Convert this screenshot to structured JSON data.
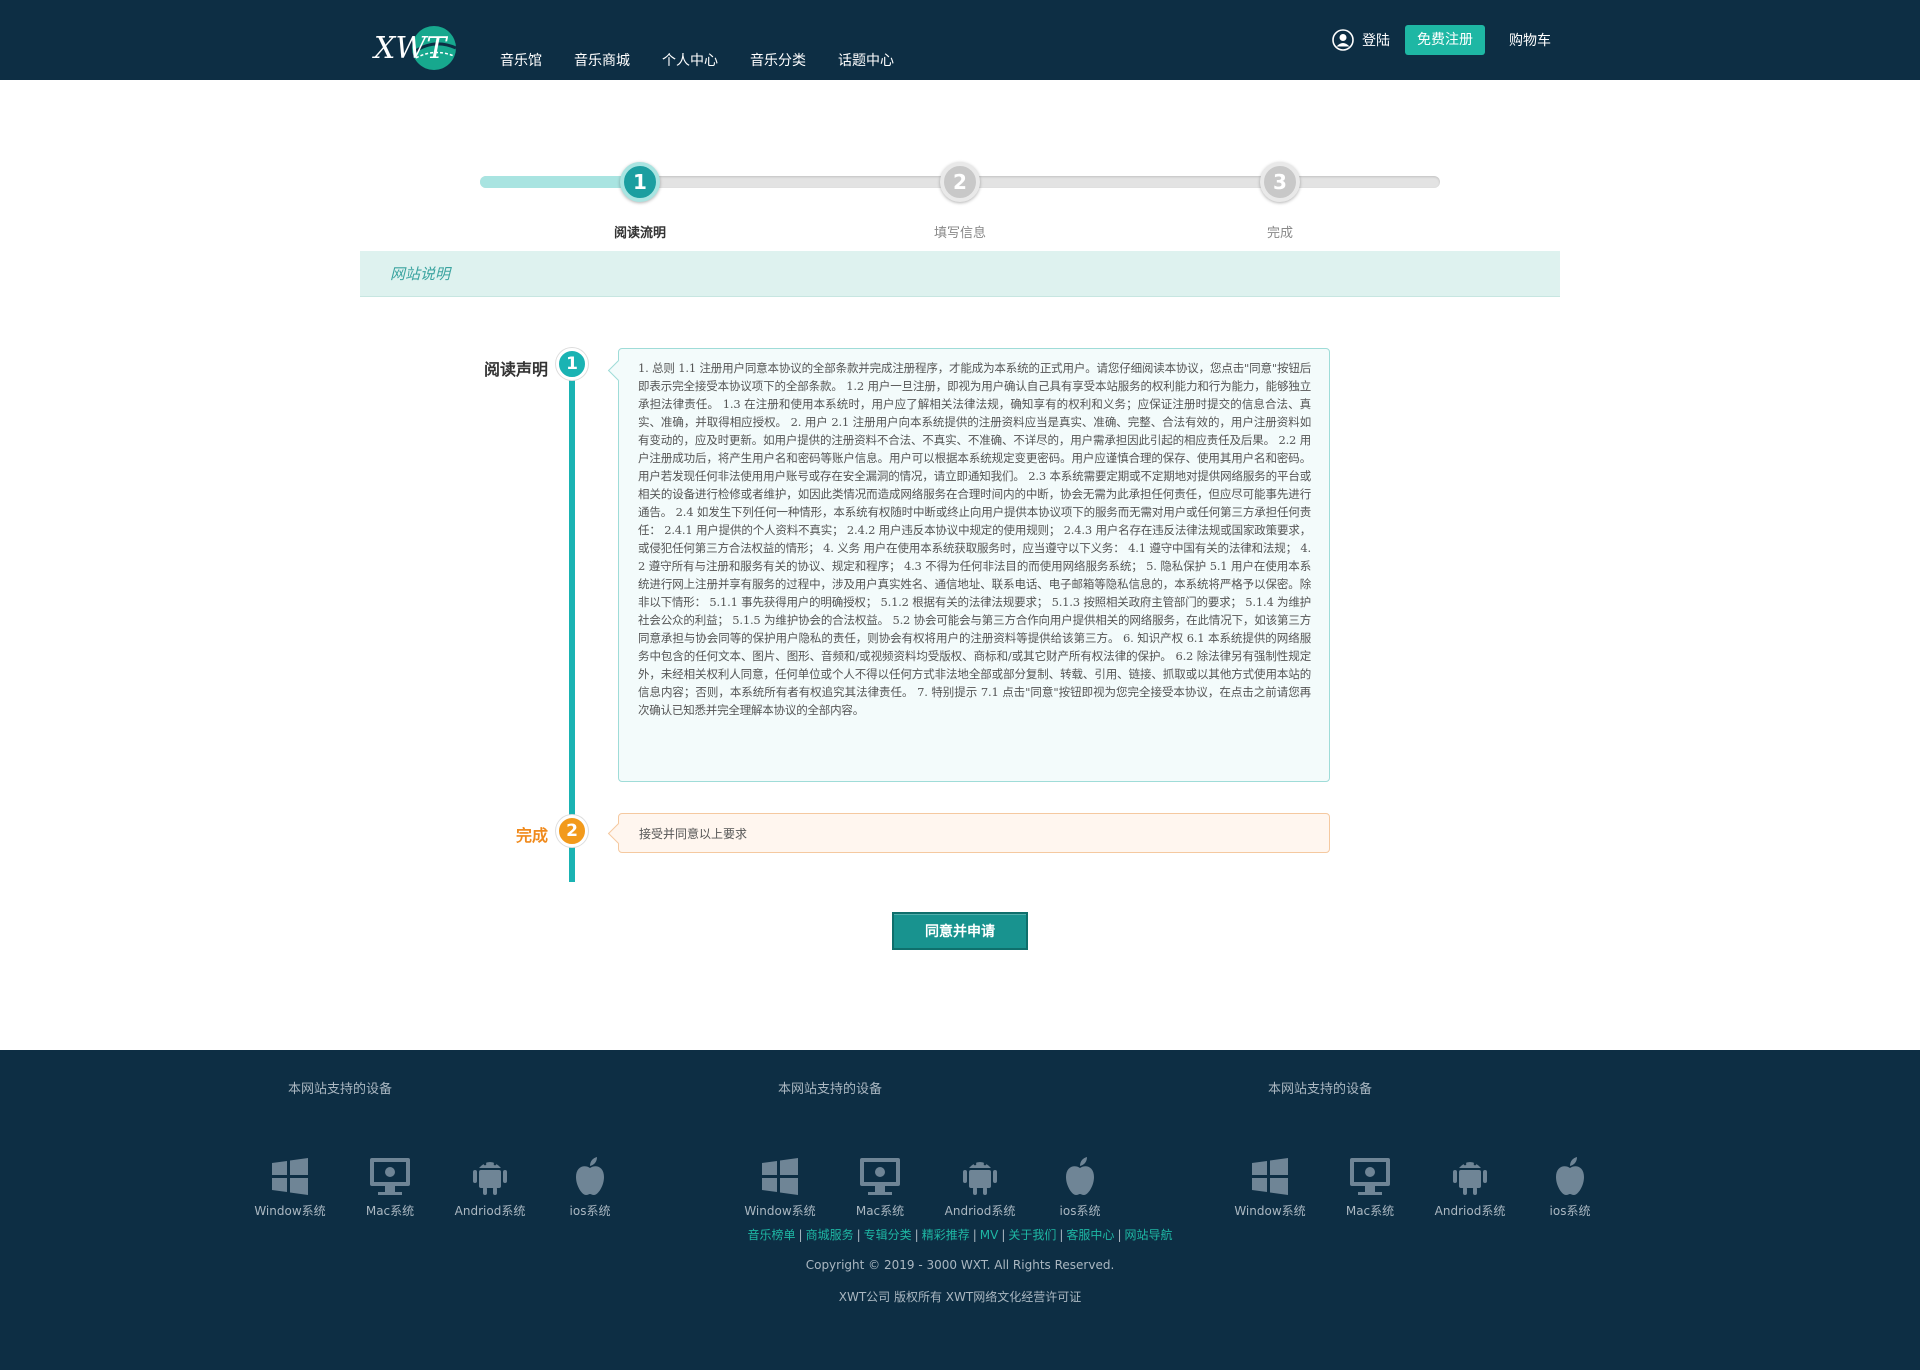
{
  "header": {
    "logo_text": "XWT",
    "nav": [
      "音乐馆",
      "音乐商城",
      "个人中心",
      "音乐分类",
      "话题中心"
    ],
    "login_label": "登陆",
    "register_label": "免费注册",
    "cart_label": "购物车",
    "colors": {
      "bar": "#0d2e44",
      "accent": "#1eb7a4"
    }
  },
  "steps": {
    "items": [
      {
        "number": "1",
        "label": "阅读流明",
        "active": true
      },
      {
        "number": "2",
        "label": "填写信息",
        "active": false
      },
      {
        "number": "3",
        "label": "完成",
        "active": false
      }
    ]
  },
  "section": {
    "title": "网站说明"
  },
  "timeline": {
    "read_title": "阅读声明",
    "read_number": "1",
    "agreement_text": "1. 总则 1.1 注册用户同意本协议的全部条款并完成注册程序，才能成为本系统的正式用户。请您仔细阅读本协议，您点击\"同意\"按钮后即表示完全接受本协议项下的全部条款。 1.2 用户一旦注册，即视为用户确认自己具有享受本站服务的权利能力和行为能力，能够独立承担法律责任。 1.3 在注册和使用本系统时，用户应了解相关法律法规，确知享有的权利和义务；应保证注册时提交的信息合法、真实、准确，并取得相应授权。 2. 用户 2.1 注册用户向本系统提供的注册资料应当是真实、准确、完整、合法有效的，用户注册资料如有变动的，应及时更新。如用户提供的注册资料不合法、不真实、不准确、不详尽的，用户需承担因此引起的相应责任及后果。 2.2 用户注册成功后，将产生用户名和密码等账户信息。用户可以根据本系统规定变更密码。用户应谨慎合理的保存、使用其用户名和密码。用户若发现任何非法使用用户账号或存在安全漏洞的情况，请立即通知我们。 2.3 本系统需要定期或不定期地对提供网络服务的平台或相关的设备进行检修或者维护，如因此类情况而造成网络服务在合理时间内的中断，协会无需为此承担任何责任，但应尽可能事先进行通告。 2.4 如发生下列任何一种情形，本系统有权随时中断或终止向用户提供本协议项下的服务而无需对用户或任何第三方承担任何责任： 2.4.1 用户提供的个人资料不真实； 2.4.2 用户违反本协议中规定的使用规则； 2.4.3 用户名存在违反法律法规或国家政策要求，或侵犯任何第三方合法权益的情形； 4. 义务 用户在使用本系统获取服务时，应当遵守以下义务： 4.1 遵守中国有关的法律和法规； 4.2 遵守所有与注册和服务有关的协议、规定和程序； 4.3 不得为任何非法目的而使用网络服务系统； 5. 隐私保护 5.1 用户在使用本系统进行网上注册并享有服务的过程中，涉及用户真实姓名、通信地址、联系电话、电子邮箱等隐私信息的，本系统将严格予以保密。除非以下情形： 5.1.1 事先获得用户的明确授权； 5.1.2 根据有关的法律法规要求； 5.1.3 按照相关政府主管部门的要求； 5.1.4 为维护社会公众的利益； 5.1.5 为维护协会的合法权益。 5.2 协会可能会与第三方合作向用户提供相关的网络服务，在此情况下，如该第三方同意承担与协会同等的保护用户隐私的责任，则协会有权将用户的注册资料等提供给该第三方。 6. 知识产权 6.1 本系统提供的网络服务中包含的任何文本、图片、图形、音频和/或视频资料均受版权、商标和/或其它财产所有权法律的保护。 6.2 除法律另有强制性规定外，未经相关权利人同意，任何单位或个人不得以任何方式非法地全部或部分复制、转载、引用、链接、抓取或以其他方式使用本站的信息内容；否则，本系统所有者有权追究其法律责任。 7. 特别提示 7.1 点击\"同意\"按钮即视为您完全接受本协议，在点击之前请您再次确认已知悉并完全理解本协议的全部内容。",
    "done_title": "完成",
    "done_number": "2",
    "accept_text": "接受并同意以上要求"
  },
  "agree_button": "同意并申请",
  "footer": {
    "device_groups": [
      {
        "title": "本网站支持的设备",
        "devices": [
          "Window系统",
          "Mac系统",
          "Andriod系统",
          "ios系统"
        ]
      },
      {
        "title": "本网站支持的设备",
        "devices": [
          "Window系统",
          "Mac系统",
          "Andriod系统",
          "ios系统"
        ]
      },
      {
        "title": "本网站支持的设备",
        "devices": [
          "Window系统",
          "Mac系统",
          "Andriod系统",
          "ios系统"
        ]
      }
    ],
    "device_icons": [
      "windows-icon",
      "mac-monitor-icon",
      "android-icon",
      "apple-icon"
    ],
    "links": [
      "音乐榜单",
      "商城服务",
      "专辑分类",
      "精彩推荐",
      "MV",
      "关于我们",
      "客服中心",
      "网站导航"
    ],
    "copyright": "Copyright © 2019 - 3000 WXT. All Rights Reserved.",
    "license": "XWT公司 版权所有 XWT网络文化经营许可证"
  }
}
